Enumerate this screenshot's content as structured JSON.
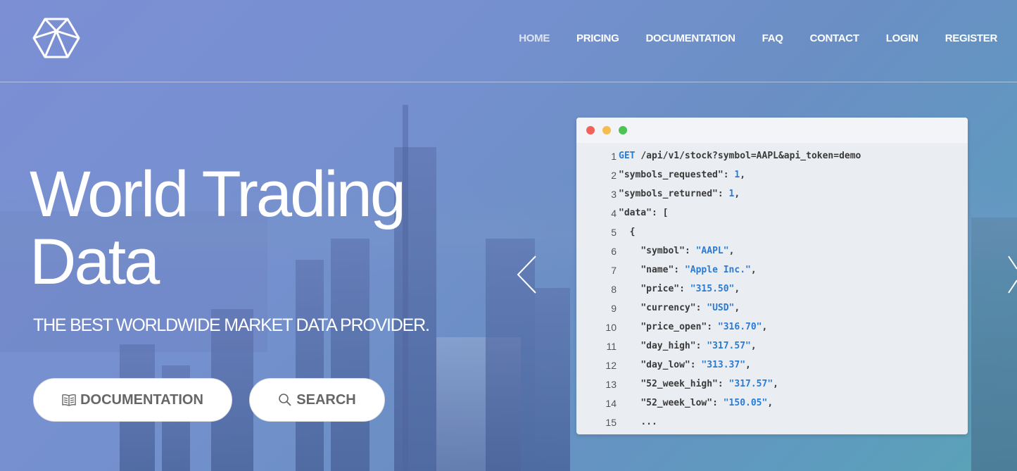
{
  "nav": {
    "items": [
      {
        "label": "HOME",
        "active": true
      },
      {
        "label": "PRICING",
        "active": false
      },
      {
        "label": "DOCUMENTATION",
        "active": false
      },
      {
        "label": "FAQ",
        "active": false
      },
      {
        "label": "CONTACT",
        "active": false
      },
      {
        "label": "LOGIN",
        "active": false
      },
      {
        "label": "REGISTER",
        "active": false
      }
    ]
  },
  "hero": {
    "title_line1": "World Trading",
    "title_line2": "Data",
    "subtitle": "THE BEST WORLDWIDE MARKET DATA PROVIDER.",
    "documentation_button": "DOCUMENTATION",
    "search_button": "SEARCH"
  },
  "code_window": {
    "dot_colors": [
      "#f0625a",
      "#f5bd4f",
      "#4cc352"
    ],
    "lines": [
      {
        "n": "1",
        "indent": "",
        "key": "GET",
        "sep": " ",
        "value": "",
        "tail": "/api/v1/stock?symbol=AAPL&api_token=demo"
      },
      {
        "n": "2",
        "indent": "",
        "key": "\"symbols_requested\"",
        "sep": ": ",
        "value": "1",
        "tail": ","
      },
      {
        "n": "3",
        "indent": "",
        "key": "\"symbols_returned\"",
        "sep": ": ",
        "value": "1",
        "tail": ","
      },
      {
        "n": "4",
        "indent": "",
        "key": "\"data\"",
        "sep": ": ",
        "value": "",
        "tail": "["
      },
      {
        "n": "5",
        "indent": "  ",
        "key": "{",
        "sep": "",
        "value": "",
        "tail": ""
      },
      {
        "n": "6",
        "indent": "    ",
        "key": "\"symbol\"",
        "sep": ": ",
        "value": "\"AAPL\"",
        "tail": ","
      },
      {
        "n": "7",
        "indent": "    ",
        "key": "\"name\"",
        "sep": ": ",
        "value": "\"Apple Inc.\"",
        "tail": ","
      },
      {
        "n": "8",
        "indent": "    ",
        "key": "\"price\"",
        "sep": ": ",
        "value": "\"315.50\"",
        "tail": ","
      },
      {
        "n": "9",
        "indent": "    ",
        "key": "\"currency\"",
        "sep": ": ",
        "value": "\"USD\"",
        "tail": ","
      },
      {
        "n": "10",
        "indent": "    ",
        "key": "\"price_open\"",
        "sep": ": ",
        "value": "\"316.70\"",
        "tail": ","
      },
      {
        "n": "11",
        "indent": "    ",
        "key": "\"day_high\"",
        "sep": ": ",
        "value": "\"317.57\"",
        "tail": ","
      },
      {
        "n": "12",
        "indent": "    ",
        "key": "\"day_low\"",
        "sep": ": ",
        "value": "\"313.37\"",
        "tail": ","
      },
      {
        "n": "13",
        "indent": "    ",
        "key": "\"52_week_high\"",
        "sep": ": ",
        "value": "\"317.57\"",
        "tail": ","
      },
      {
        "n": "14",
        "indent": "    ",
        "key": "\"52_week_low\"",
        "sep": ": ",
        "value": "\"150.05\"",
        "tail": ","
      },
      {
        "n": "15",
        "indent": "    ",
        "key": "...",
        "sep": "",
        "value": "",
        "tail": ""
      }
    ]
  },
  "icons": {
    "logo": "polyhedron-logo-icon",
    "documentation": "book-icon",
    "search": "search-icon",
    "carousel_prev": "chevron-left-icon",
    "carousel_next": "chevron-right-icon"
  },
  "colors": {
    "accent": "#2a7bd4",
    "button_text": "#666666"
  }
}
